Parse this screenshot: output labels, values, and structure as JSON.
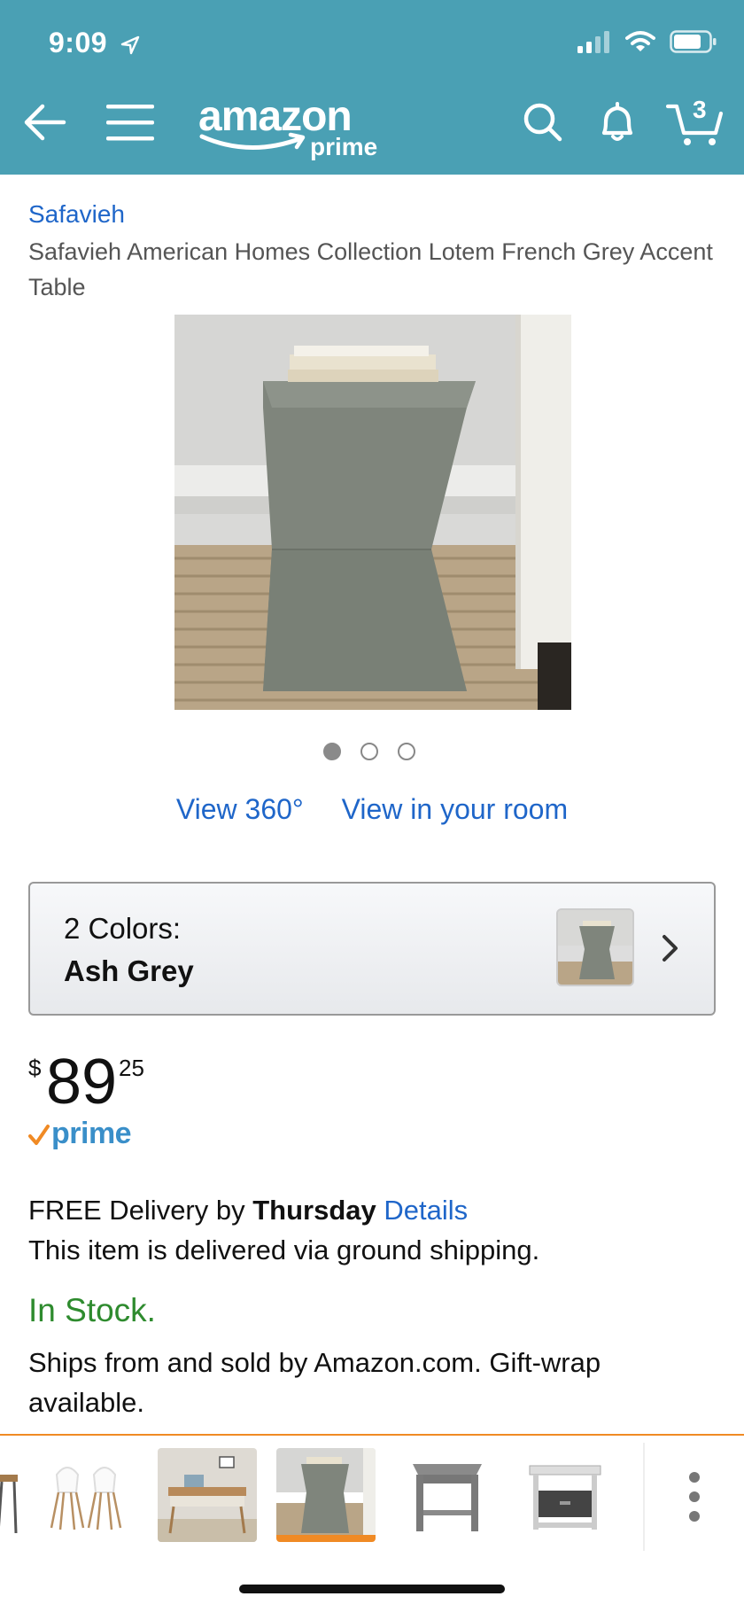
{
  "status_bar": {
    "time": "9:09",
    "location_icon": "location-arrow-icon",
    "signal_icon": "signal-icon",
    "wifi_icon": "wifi-icon",
    "battery_icon": "battery-icon"
  },
  "navbar": {
    "back_icon": "back-arrow-icon",
    "menu_icon": "hamburger-menu-icon",
    "logo_word": "amazon",
    "logo_prime": "prime",
    "search_icon": "search-icon",
    "notifications_icon": "bell-icon",
    "cart_icon": "cart-icon",
    "cart_count": "3"
  },
  "product": {
    "brand": "Safavieh",
    "title": "Safavieh American Homes Collection Lotem French Grey Accent Table",
    "image_pages": 3,
    "current_image_page": 1,
    "view_360": "View 360°",
    "view_in_room": "View in your room"
  },
  "color_selector": {
    "count_label": "2 Colors:",
    "selected": "Ash Grey"
  },
  "price": {
    "currency": "$",
    "whole": "89",
    "fraction": "25",
    "prime_label": "prime"
  },
  "delivery": {
    "free_text": "FREE Delivery by ",
    "day": "Thursday",
    "details_link": "Details",
    "ground_text": "This item is delivered via ground shipping."
  },
  "stock": {
    "status": "In Stock.",
    "ships_text": "Ships from and sold by Amazon.com. Gift-wrap available."
  },
  "colors": {
    "header_bg": "#4aa0b4",
    "link": "#1f66c9",
    "in_stock": "#2e8b2e",
    "accent_orange": "#f08a24",
    "prime_blue": "#3a8fc9"
  }
}
